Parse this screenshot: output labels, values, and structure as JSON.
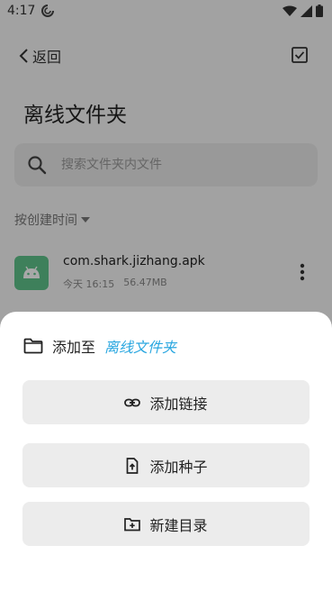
{
  "status_bar": {
    "time": "4:17"
  },
  "header": {
    "back_label": "返回"
  },
  "page": {
    "title": "离线文件夹"
  },
  "search": {
    "placeholder": "搜索文件夹内文件"
  },
  "sort": {
    "label": "按创建时间"
  },
  "files": [
    {
      "name": "com.shark.jizhang.apk",
      "date": "今天 16:15",
      "size": "56.47MB"
    }
  ],
  "sheet": {
    "prefix": "添加至",
    "destination": "离线文件夹",
    "add_link_label": "添加链接",
    "add_seed_label": "添加种子",
    "new_folder_label": "新建目录"
  },
  "colors": {
    "accent": "#2aa7e0",
    "apk_icon": "#5fc38a"
  }
}
